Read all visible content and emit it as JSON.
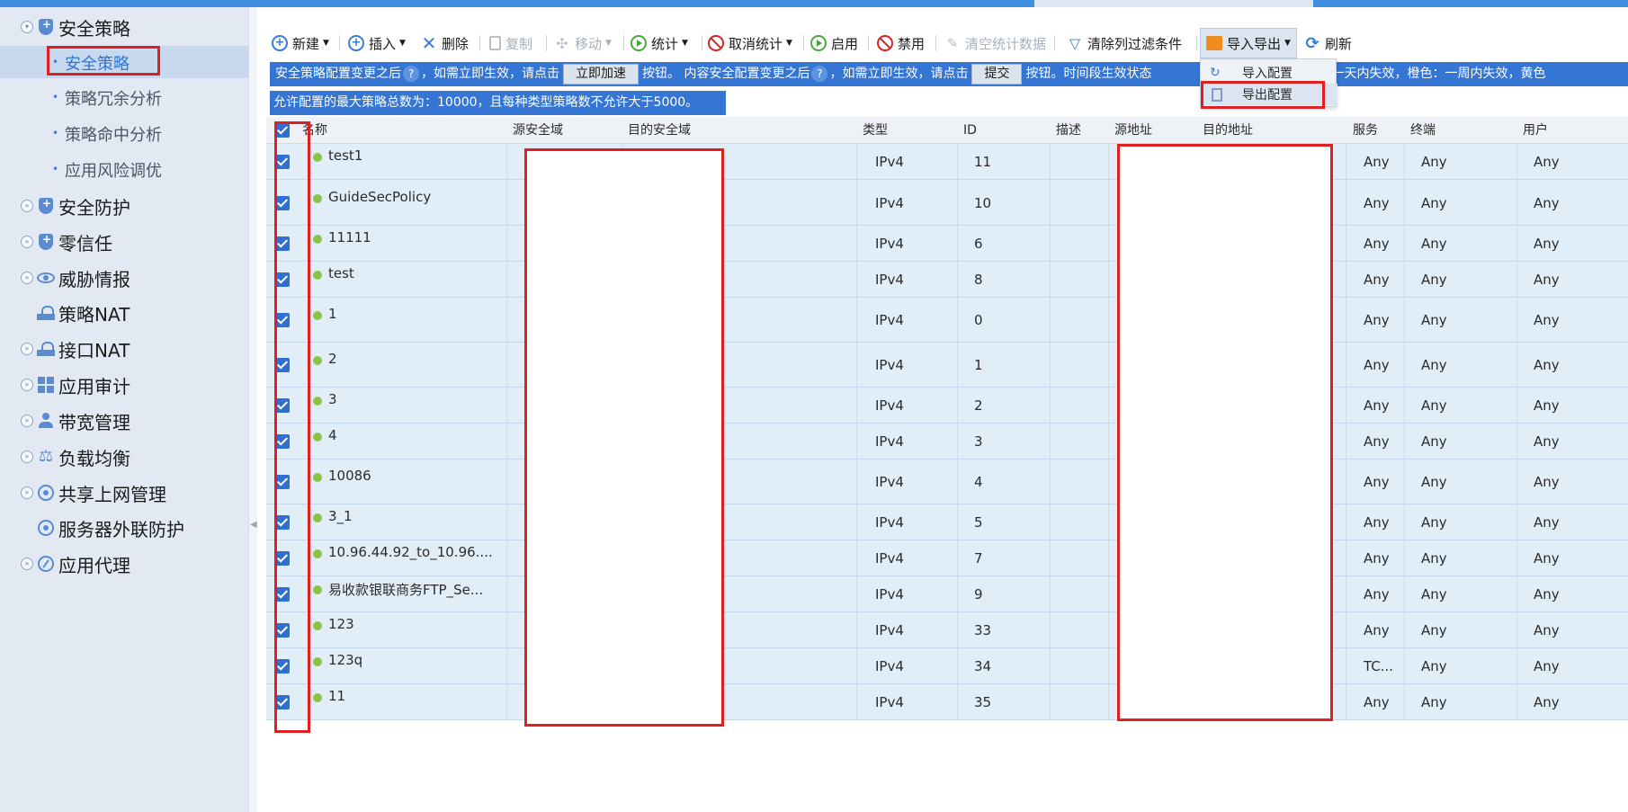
{
  "sidebar": {
    "items": [
      {
        "label": "安全策略",
        "icon": "shield-icon"
      },
      {
        "label": "安全防护",
        "icon": "shield-icon"
      },
      {
        "label": "零信任",
        "icon": "shield-icon"
      },
      {
        "label": "威胁情报",
        "icon": "eye-icon"
      },
      {
        "label": "策略NAT",
        "icon": "nat-icon"
      },
      {
        "label": "接口NAT",
        "icon": "nat-icon"
      },
      {
        "label": "应用审计",
        "icon": "grid-icon"
      },
      {
        "label": "带宽管理",
        "icon": "people-icon"
      },
      {
        "label": "负载均衡",
        "icon": "scale-icon"
      },
      {
        "label": "共享上网管理",
        "icon": "share-icon"
      },
      {
        "label": "服务器外联防护",
        "icon": "server-icon"
      },
      {
        "label": "应用代理",
        "icon": "compass-icon"
      }
    ],
    "subitems": [
      {
        "label": "安全策略"
      },
      {
        "label": "策略冗余分析"
      },
      {
        "label": "策略命中分析"
      },
      {
        "label": "应用风险调优"
      }
    ]
  },
  "toolbar": {
    "new": "新建",
    "insert": "插入",
    "delete": "删除",
    "copy": "复制",
    "move": "移动",
    "stats": "统计",
    "cancel_stats": "取消统计",
    "enable": "启用",
    "disable": "禁用",
    "clear_stats": "清空统计数据",
    "clear_filter": "清除列过滤条件",
    "import_export": "导入导出",
    "refresh": "刷新"
  },
  "dropdown": {
    "import": "导入配置",
    "export": "导出配置"
  },
  "notice": {
    "part1": "安全策略配置变更之后",
    "part2": "，如需立即生效，请点击",
    "accelerate_btn": "立即加速",
    "part3": "按钮。 内容安全配置变更之后",
    "part4": "，如需立即生效，请点击",
    "submit_btn": "提交",
    "part5": "按钮。时间段生效状态",
    "part6": "效，红色：一天内失效，橙色：一周内失效，黄色",
    "line2": "允许配置的最大策略总数为：10000，且每种类型策略数不允许大于5000。"
  },
  "table": {
    "headers": {
      "name": "名称",
      "src_zone": "源安全域",
      "dst_zone": "目的安全域",
      "type": "类型",
      "id": "ID",
      "desc": "描述",
      "src_addr": "源地址",
      "dst_addr": "目的地址",
      "service": "服务",
      "terminal": "终端",
      "user": "用户"
    },
    "rows": [
      {
        "name": "test1",
        "type": "IPv4",
        "id": "11",
        "service": "Any",
        "terminal": "Any",
        "user": "Any"
      },
      {
        "name": "GuideSecPolicy",
        "type": "IPv4",
        "id": "10",
        "service": "Any",
        "terminal": "Any",
        "user": "Any"
      },
      {
        "name": "11111",
        "type": "IPv4",
        "id": "6",
        "service": "Any",
        "terminal": "Any",
        "user": "Any"
      },
      {
        "name": "test",
        "type": "IPv4",
        "id": "8",
        "service": "Any",
        "terminal": "Any",
        "user": "Any"
      },
      {
        "name": "1",
        "type": "IPv4",
        "id": "0",
        "service": "Any",
        "terminal": "Any",
        "user": "Any"
      },
      {
        "name": "2",
        "type": "IPv4",
        "id": "1",
        "service": "Any",
        "terminal": "Any",
        "user": "Any"
      },
      {
        "name": "3",
        "type": "IPv4",
        "id": "2",
        "service": "Any",
        "terminal": "Any",
        "user": "Any"
      },
      {
        "name": "4",
        "type": "IPv4",
        "id": "3",
        "service": "Any",
        "terminal": "Any",
        "user": "Any"
      },
      {
        "name": "10086",
        "type": "IPv4",
        "id": "4",
        "service": "Any",
        "terminal": "Any",
        "user": "Any"
      },
      {
        "name": "3_1",
        "type": "IPv4",
        "id": "5",
        "service": "Any",
        "terminal": "Any",
        "user": "Any"
      },
      {
        "name": "10.96.44.92_to_10.96....",
        "type": "IPv4",
        "id": "7",
        "service": "Any",
        "terminal": "Any",
        "user": "Any"
      },
      {
        "name": "易收款银联商务FTP_Se...",
        "type": "IPv4",
        "id": "9",
        "service": "Any",
        "terminal": "Any",
        "user": "Any"
      },
      {
        "name": "123",
        "type": "IPv4",
        "id": "33",
        "service": "Any",
        "terminal": "Any",
        "user": "Any"
      },
      {
        "name": "123q",
        "type": "IPv4",
        "id": "34",
        "service": "TC...",
        "terminal": "Any",
        "user": "Any"
      },
      {
        "name": "11",
        "type": "IPv4",
        "id": "35",
        "service": "Any",
        "terminal": "Any",
        "user": "Any"
      }
    ]
  },
  "colors": {
    "accent": "#3575d3",
    "row_bg": "#e1eef8",
    "highlight_red": "#e02020",
    "status_green": "#8bc34a"
  }
}
